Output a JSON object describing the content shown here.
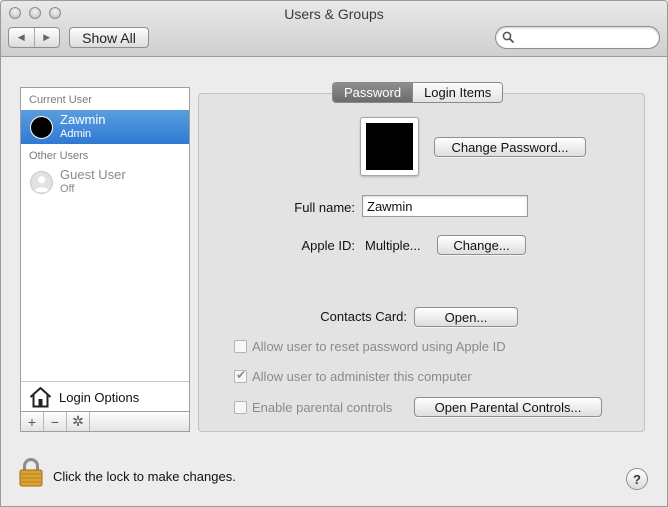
{
  "window": {
    "title": "Users & Groups",
    "nav_back": "◀",
    "nav_forward": "▶",
    "show_all": "Show All",
    "search_placeholder": ""
  },
  "sidebar": {
    "current_user_heading": "Current User",
    "current_user": {
      "name": "Zawmin",
      "role": "Admin",
      "selected": true
    },
    "other_users_heading": "Other Users",
    "other_users": [
      {
        "name": "Guest User",
        "role": "Off"
      }
    ],
    "login_options_label": "Login Options",
    "footer_buttons": {
      "add": "+",
      "remove": "−",
      "actions": "✲"
    }
  },
  "tabs": [
    {
      "label": "Password",
      "active": true
    },
    {
      "label": "Login Items",
      "active": false
    }
  ],
  "password_pane": {
    "change_password_button": "Change Password...",
    "full_name_label": "Full name:",
    "full_name_value": "Zawmin",
    "apple_id_label": "Apple ID:",
    "apple_id_value": "Multiple...",
    "apple_id_change_button": "Change...",
    "contacts_card_label": "Contacts Card:",
    "contacts_card_button": "Open...",
    "options": [
      {
        "label": "Allow user to reset password using Apple ID",
        "checked": false,
        "enabled": false
      },
      {
        "label": "Allow user to administer this computer",
        "checked": true,
        "enabled": false
      },
      {
        "label": "Enable parental controls",
        "checked": false,
        "enabled": false
      }
    ],
    "open_parental_controls_button": "Open Parental Controls..."
  },
  "footer": {
    "lock_message": "Click the lock to make changes.",
    "help_label": "?"
  },
  "colors": {
    "selection": "#3a84d6",
    "window_bg": "#ececec",
    "pane_bg": "#e3e3e3",
    "disabled_text": "#8a8a8a",
    "lock_gold": "#d9a233"
  },
  "icons": {
    "search": "search-icon",
    "home": "house-icon",
    "lock": "lock-icon",
    "gear": "gear-icon",
    "guest_avatar": "user-silhouette-icon"
  }
}
